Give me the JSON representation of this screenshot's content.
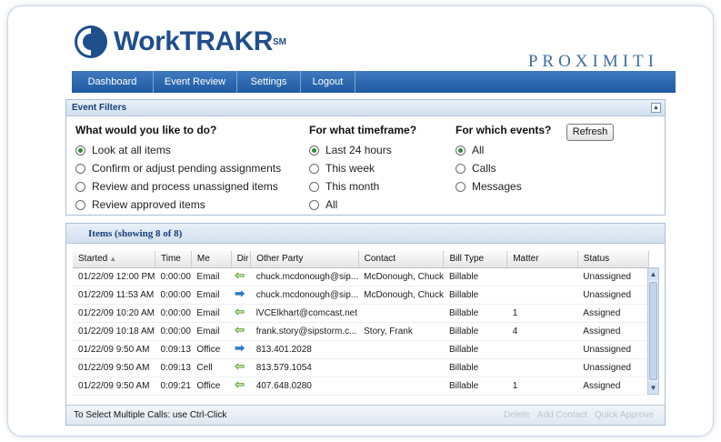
{
  "header": {
    "logo_text": "WorkTRAKR",
    "logo_superscript": "SM",
    "brand": "PROXIMITI"
  },
  "nav": {
    "items": [
      "Dashboard",
      "Event Review",
      "Settings",
      "Logout"
    ]
  },
  "filters": {
    "title": "Event Filters",
    "collapse_icon": "▲",
    "refresh_label": "Refresh",
    "what": {
      "question": "What would you like to do?",
      "options": [
        "Look at all items",
        "Confirm or adjust pending assignments",
        "Review and process unassigned items",
        "Review approved items"
      ],
      "selected": 0
    },
    "timeframe": {
      "question": "For what timeframe?",
      "options": [
        "Last 24 hours",
        "This week",
        "This month",
        "All"
      ],
      "selected": 0
    },
    "events": {
      "question": "For which events?",
      "options": [
        "All",
        "Calls",
        "Messages"
      ],
      "selected": 0
    }
  },
  "items": {
    "title": "Items (showing 8 of 8)",
    "columns": [
      "Started",
      "Time",
      "Me",
      "Dir",
      "Other Party",
      "Contact",
      "Bill Type",
      "Matter",
      "Status"
    ],
    "sort_icon": "▲",
    "rows": [
      {
        "started": "01/22/09 12:00 PM",
        "time": "0:00:00",
        "me": "Email",
        "dir": "in",
        "other": "chuck.mcdonough@sip...",
        "contact": "McDonough, Chuck",
        "bill": "Billable",
        "matter": "",
        "status": "Unassigned"
      },
      {
        "started": "01/22/09 11:53 AM",
        "time": "0:00:00",
        "me": "Email",
        "dir": "out",
        "other": "chuck.mcdonough@sip...",
        "contact": "McDonough, Chuck",
        "bill": "Billable",
        "matter": "",
        "status": "Unassigned"
      },
      {
        "started": "01/22/09 10:20 AM",
        "time": "0:00:00",
        "me": "Email",
        "dir": "in",
        "other": "lVCElkhart@comcast.net",
        "contact": "",
        "bill": "Billable",
        "matter": "1",
        "status": "Assigned"
      },
      {
        "started": "01/22/09 10:18 AM",
        "time": "0:00:00",
        "me": "Email",
        "dir": "in",
        "other": "frank.story@sipstorm.c...",
        "contact": "Story, Frank",
        "bill": "Billable",
        "matter": "4",
        "status": "Assigned"
      },
      {
        "started": "01/22/09 9:50 AM",
        "time": "0:09:13",
        "me": "Office",
        "dir": "out",
        "other": "813.401.2028",
        "contact": "",
        "bill": "Billable",
        "matter": "",
        "status": "Unassigned"
      },
      {
        "started": "01/22/09 9:50 AM",
        "time": "0:09:13",
        "me": "Cell",
        "dir": "in",
        "other": "813.579.1054",
        "contact": "",
        "bill": "Billable",
        "matter": "",
        "status": "Unassigned"
      },
      {
        "started": "01/22/09 9:50 AM",
        "time": "0:09:21",
        "me": "Office",
        "dir": "in",
        "other": "407.648.0280",
        "contact": "",
        "bill": "Billable",
        "matter": "1",
        "status": "Assigned"
      }
    ],
    "footer_text": "To Select Multiple Calls: use Ctrl-Click",
    "actions": [
      "Delete",
      "Add Contact",
      "Quick Approve"
    ]
  },
  "icons": {
    "in_arrow": "⇦",
    "out_arrow": "➡",
    "scroll_up": "▲",
    "scroll_down": "▼"
  },
  "colors": {
    "nav": "#1f5aa2",
    "brand": "#3d6da3",
    "selected_radio": "#2e8b3a",
    "in_arrow": "#6aa83c",
    "out_arrow": "#2b78c6"
  }
}
